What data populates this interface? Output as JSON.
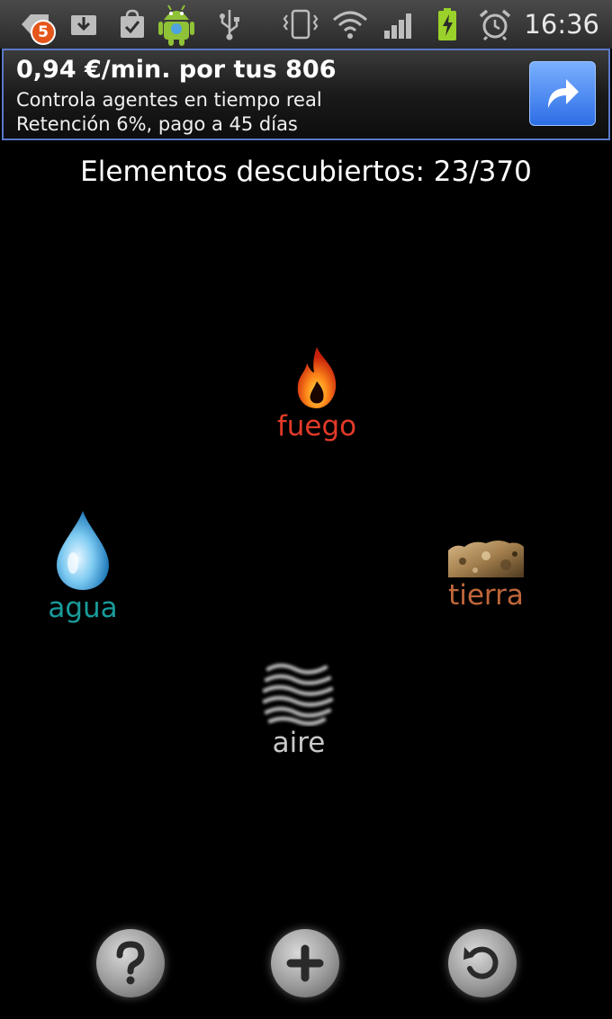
{
  "status_bar": {
    "notification_count": "5",
    "time": "16:36",
    "icons": [
      "notification-icon",
      "download-icon",
      "market-icon",
      "android-icon",
      "usb-icon",
      "vibrate-icon",
      "wifi-icon",
      "signal-icon",
      "battery-charging-icon",
      "alarm-icon"
    ]
  },
  "ad": {
    "title": "0,94 €/min. por tus 806",
    "line1": "Controla agentes en tiempo real",
    "line2": "Retención 6%, pago a 45 días",
    "button_icon": "share-arrow-icon",
    "border_color": "#5a79c7"
  },
  "counter": {
    "label": "Elementos descubiertos:",
    "value": "23/370"
  },
  "elements": {
    "fuego": {
      "label": "fuego",
      "color": "#e23a28",
      "icon": "fire-icon"
    },
    "agua": {
      "label": "agua",
      "color": "#1a9b9b",
      "icon": "water-drop-icon"
    },
    "tierra": {
      "label": "tierra",
      "color": "#c0663a",
      "icon": "earth-icon"
    },
    "aire": {
      "label": "aire",
      "color": "#c8c8c8",
      "icon": "air-icon"
    }
  },
  "buttons": {
    "help": "help-icon",
    "add": "plus-icon",
    "reset": "reset-icon"
  }
}
